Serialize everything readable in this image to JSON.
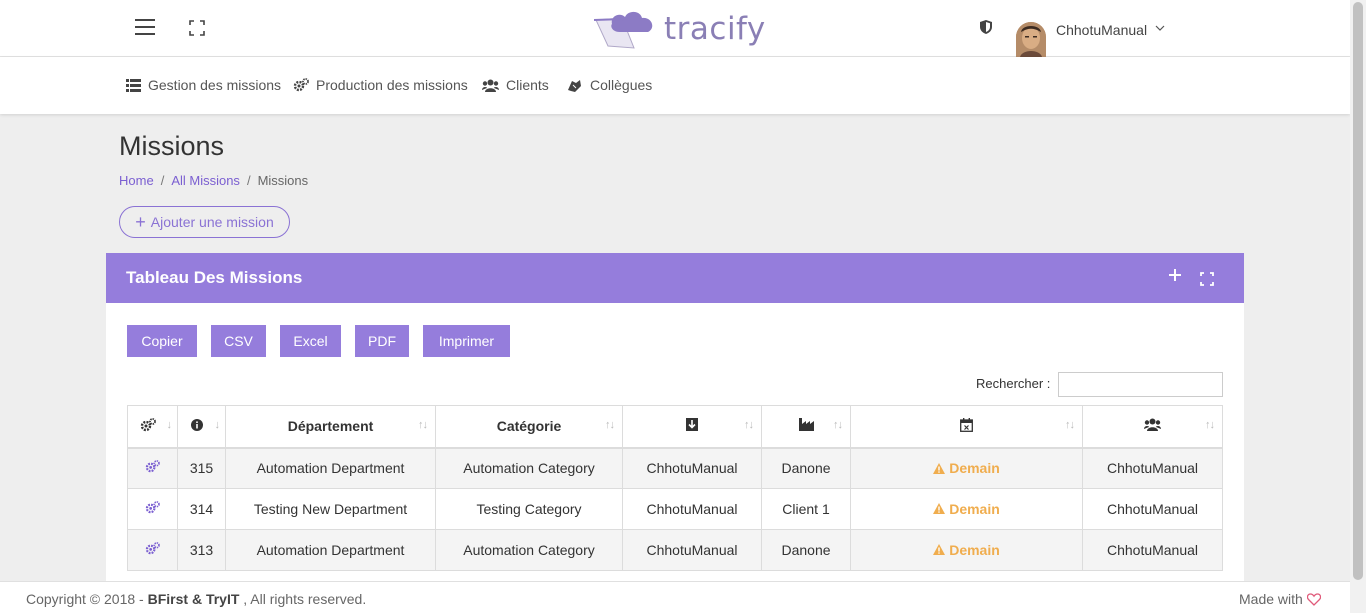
{
  "header": {
    "logo_text": "tracify",
    "user_name": "ChhotuManual"
  },
  "nav": {
    "items": [
      {
        "label": "Gestion des missions",
        "icon": "list-icon"
      },
      {
        "label": "Production des missions",
        "icon": "cogs-icon"
      },
      {
        "label": "Clients",
        "icon": "users-icon"
      },
      {
        "label": "Collègues",
        "icon": "handshake-icon"
      }
    ]
  },
  "page": {
    "title": "Missions",
    "breadcrumb": [
      "Home",
      "All Missions",
      "Missions"
    ],
    "add_button": "Ajouter une mission"
  },
  "card": {
    "title": "Tableau Des Missions",
    "export_buttons": [
      "Copier",
      "CSV",
      "Excel",
      "PDF",
      "Imprimer"
    ],
    "search_label": "Rechercher :",
    "search_value": ""
  },
  "table": {
    "columns": [
      {
        "label": "",
        "icon": "cogs-icon"
      },
      {
        "label": "",
        "icon": "info-icon"
      },
      {
        "label": "Département",
        "icon": ""
      },
      {
        "label": "Catégorie",
        "icon": ""
      },
      {
        "label": "",
        "icon": "download-icon"
      },
      {
        "label": "",
        "icon": "industry-icon"
      },
      {
        "label": "",
        "icon": "calendar-times-icon"
      },
      {
        "label": "",
        "icon": "users-icon"
      }
    ],
    "rows": [
      {
        "id": "315",
        "department": "Automation Department",
        "category": "Automation Category",
        "owner": "ChhotuManual",
        "client": "Danone",
        "due": "Demain",
        "assignee": "ChhotuManual"
      },
      {
        "id": "314",
        "department": "Testing New Department",
        "category": "Testing Category",
        "owner": "ChhotuManual",
        "client": "Client 1",
        "due": "Demain",
        "assignee": "ChhotuManual"
      },
      {
        "id": "313",
        "department": "Automation Department",
        "category": "Automation Category",
        "owner": "ChhotuManual",
        "client": "Danone",
        "due": "Demain",
        "assignee": "ChhotuManual"
      }
    ]
  },
  "footer": {
    "copyright_prefix": "Copyright © 2018 - ",
    "company": "BFirst & TryIT",
    "copyright_suffix": " , All rights reserved.",
    "made_with": "Made with"
  },
  "colors": {
    "accent": "#957ddc",
    "due_warning": "#f0ad4e"
  }
}
